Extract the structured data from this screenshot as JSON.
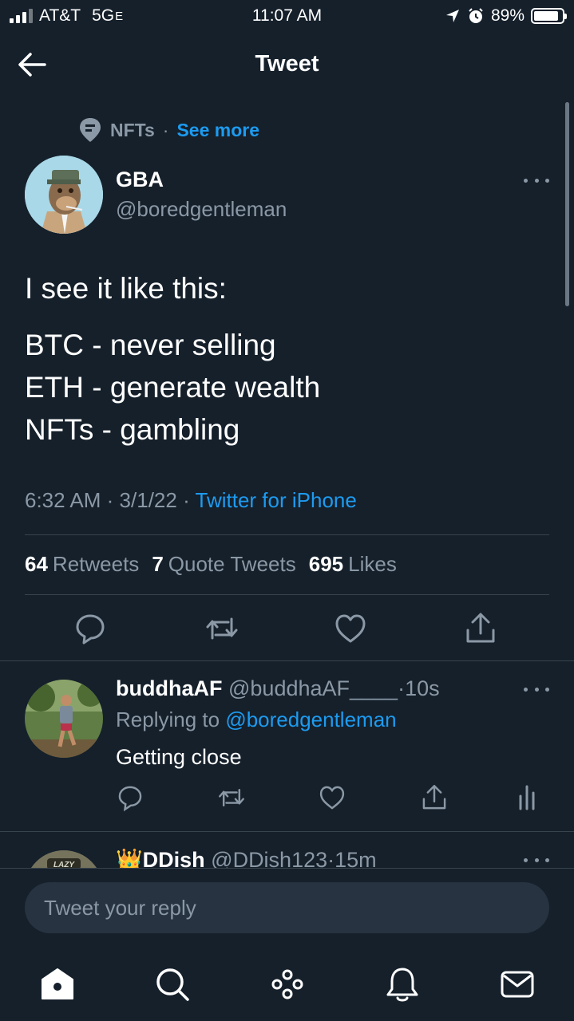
{
  "status_bar": {
    "carrier": "AT&T",
    "network": "5G",
    "network_suffix": "E",
    "time": "11:07 AM",
    "battery": "89%",
    "battery_level": 0.89
  },
  "header": {
    "title": "Tweet"
  },
  "topic": {
    "name": "NFTs",
    "separator": "·",
    "see_more": "See more"
  },
  "tweet": {
    "author_name": "GBA",
    "author_handle": "@boredgentleman",
    "lines": [
      "I see it like this:",
      "BTC - never selling",
      "ETH - generate wealth",
      "NFTs - gambling"
    ],
    "time": "6:32 AM",
    "date": "3/1/22",
    "sep": "·",
    "source": "Twitter for iPhone",
    "stats": {
      "retweets_count": "64",
      "retweets_label": "Retweets",
      "quotes_count": "7",
      "quotes_label": "Quote Tweets",
      "likes_count": "695",
      "likes_label": "Likes"
    }
  },
  "replies": [
    {
      "name": "buddhaAF",
      "handle": "@buddhaAF____",
      "time": "·10s",
      "replying_prefix": "Replying to",
      "replying_to": "@boredgentleman",
      "text": "Getting close"
    },
    {
      "name": "👑DDish",
      "handle": "@DDish123",
      "time": "·15m",
      "avatar_text": "LAZY"
    }
  ],
  "composer": {
    "placeholder": "Tweet your reply"
  },
  "colors": {
    "background": "#15202b",
    "accent": "#1d9bf0",
    "secondary_text": "#8b98a5",
    "divider": "#38444d"
  },
  "icons": [
    "back-arrow-icon",
    "topic-icon",
    "more-icon",
    "reply-icon",
    "retweet-icon",
    "like-icon",
    "share-icon",
    "analytics-icon",
    "home-icon",
    "search-icon",
    "spaces-icon",
    "notifications-icon",
    "messages-icon"
  ]
}
